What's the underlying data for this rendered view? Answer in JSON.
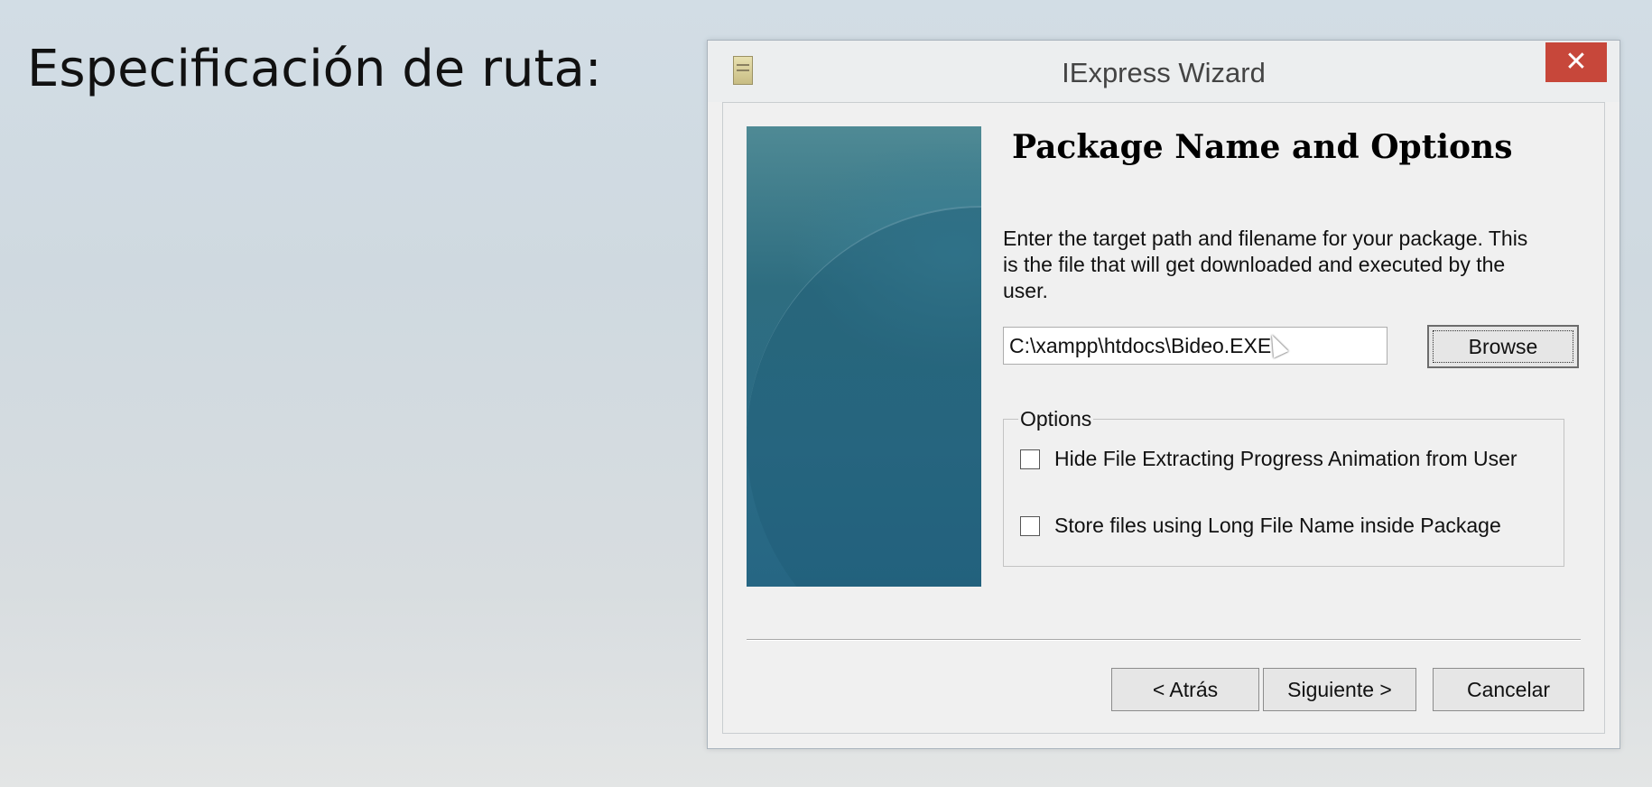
{
  "slide": {
    "title": "Especificación de ruta:"
  },
  "window": {
    "title": "IExpress Wizard",
    "close_label": "✕",
    "icon": "iexpress-app-icon"
  },
  "page": {
    "heading": "Package Name and Options",
    "description": "Enter the target path and filename for your package. This is the file that will get downloaded and executed by the user.",
    "path_value": "C:\\xampp\\htdocs\\Bideo.EXE",
    "browse_label": "Browse"
  },
  "options": {
    "legend": "Options",
    "items": [
      {
        "label": "Hide File Extracting Progress Animation from User",
        "checked": false
      },
      {
        "label": "Store files using Long File Name inside Package",
        "checked": false
      }
    ]
  },
  "footer": {
    "back_label": "< Atrás",
    "next_label": "Siguiente >",
    "cancel_label": "Cancelar"
  },
  "colors": {
    "close_button": "#c7473a",
    "banner": "#2b6c86",
    "window_bg": "#f0f0f0"
  }
}
